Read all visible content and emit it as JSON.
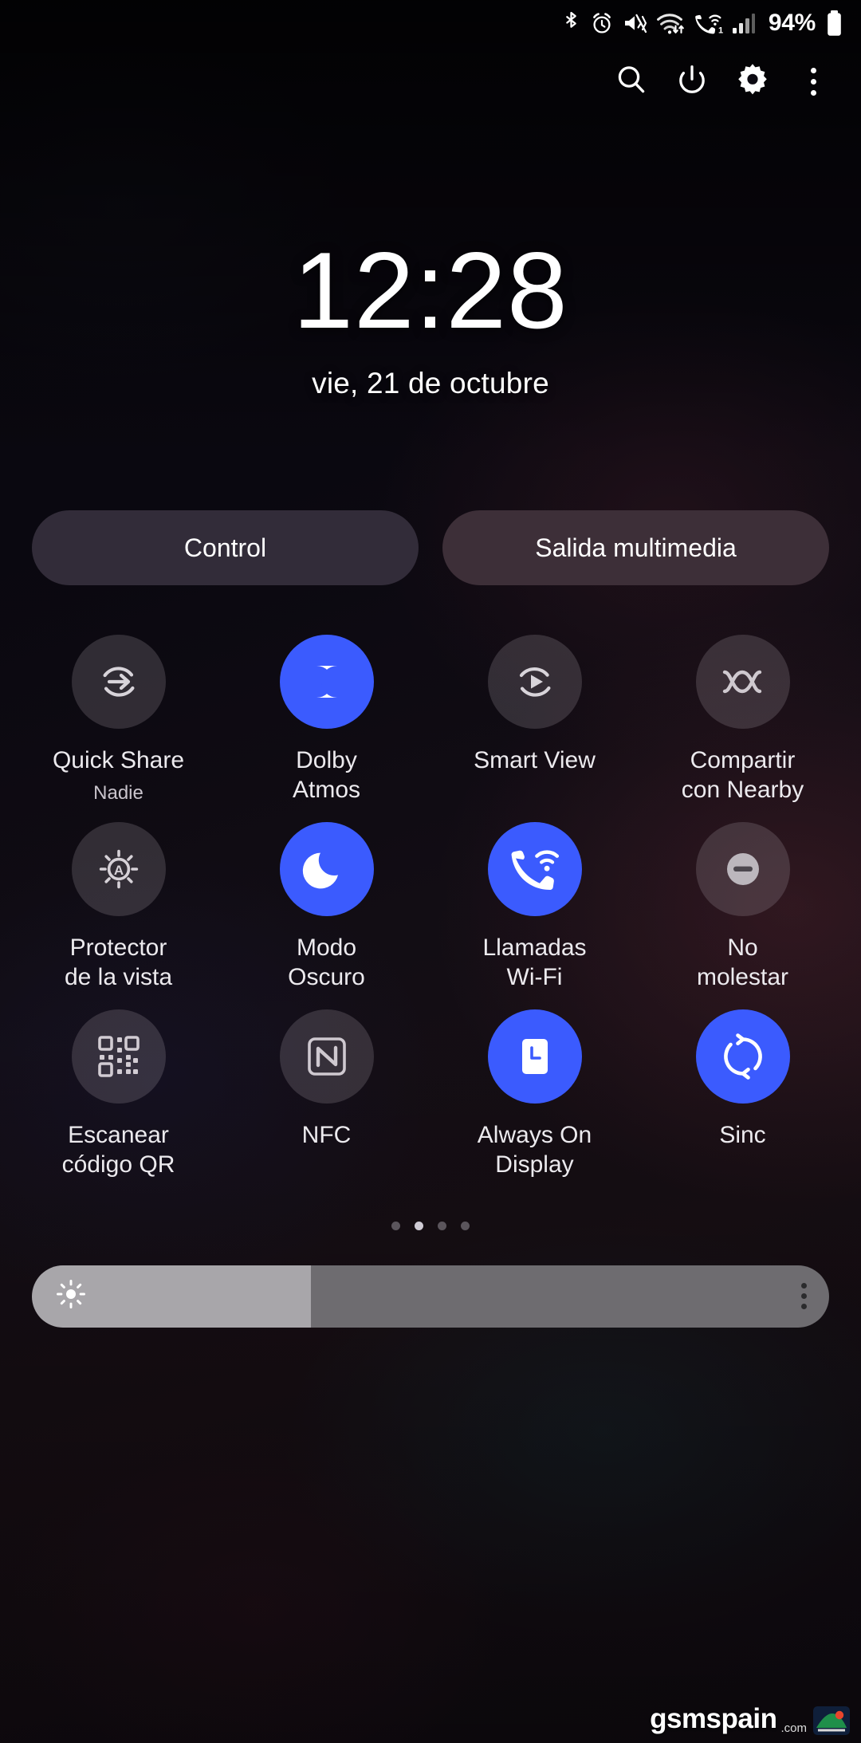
{
  "status_bar": {
    "battery_percent": "94%",
    "icons": [
      "bluetooth-icon",
      "alarm-icon",
      "mute-vibrate-icon",
      "wifi-data-icon",
      "wifi-calling-icon",
      "signal-bars-icon",
      "battery-icon"
    ],
    "sim_badge": "1"
  },
  "toolbar": {
    "search_label": "search-icon",
    "power_label": "power-icon",
    "settings_label": "gear-icon",
    "more_label": "more-options-icon"
  },
  "clock": {
    "time": "12:28",
    "date": "vie, 21 de octubre"
  },
  "pills": [
    {
      "label": "Control",
      "color": "#322c39",
      "active": false
    },
    {
      "label": "Salida multimedia",
      "color": "#3d2f38",
      "active": false
    }
  ],
  "tiles": [
    {
      "label": "Quick Share",
      "sub": "Nadie",
      "icon": "quick-share-icon",
      "active": false
    },
    {
      "label": "Dolby\nAtmos",
      "sub": "",
      "icon": "dolby-atmos-icon",
      "active": true
    },
    {
      "label": "Smart View",
      "sub": "",
      "icon": "smart-view-icon",
      "active": false
    },
    {
      "label": "Compartir\ncon Nearby",
      "sub": "",
      "icon": "nearby-share-icon",
      "active": false
    },
    {
      "label": "Protector\nde la vista",
      "sub": "",
      "icon": "eye-comfort-shield-icon",
      "active": false
    },
    {
      "label": "Modo\nOscuro",
      "sub": "",
      "icon": "dark-mode-moon-icon",
      "active": true
    },
    {
      "label": "Llamadas\nWi-Fi",
      "sub": "",
      "icon": "wifi-calling-icon",
      "active": true
    },
    {
      "label": "No\nmolestar",
      "sub": "",
      "icon": "do-not-disturb-icon",
      "active": false
    },
    {
      "label": "Escanear\ncódigo QR",
      "sub": "",
      "icon": "qr-scanner-icon",
      "active": false
    },
    {
      "label": "NFC",
      "sub": "",
      "icon": "nfc-icon",
      "active": false
    },
    {
      "label": "Always On\nDisplay",
      "sub": "",
      "icon": "always-on-display-icon",
      "active": true
    },
    {
      "label": "Sinc",
      "sub": "",
      "icon": "sync-icon",
      "active": true
    }
  ],
  "pagination": {
    "count": 4,
    "active_index": 1
  },
  "brightness": {
    "value_percent": 35,
    "icon": "brightness-sun-icon",
    "menu": "brightness-more-icon"
  },
  "watermark": {
    "name": "gsmspain",
    "suffix": ".com"
  },
  "colors": {
    "accent": "#3b5bfe",
    "tile_off": "rgba(176,168,176,0.22)",
    "text": "#ffffff"
  }
}
